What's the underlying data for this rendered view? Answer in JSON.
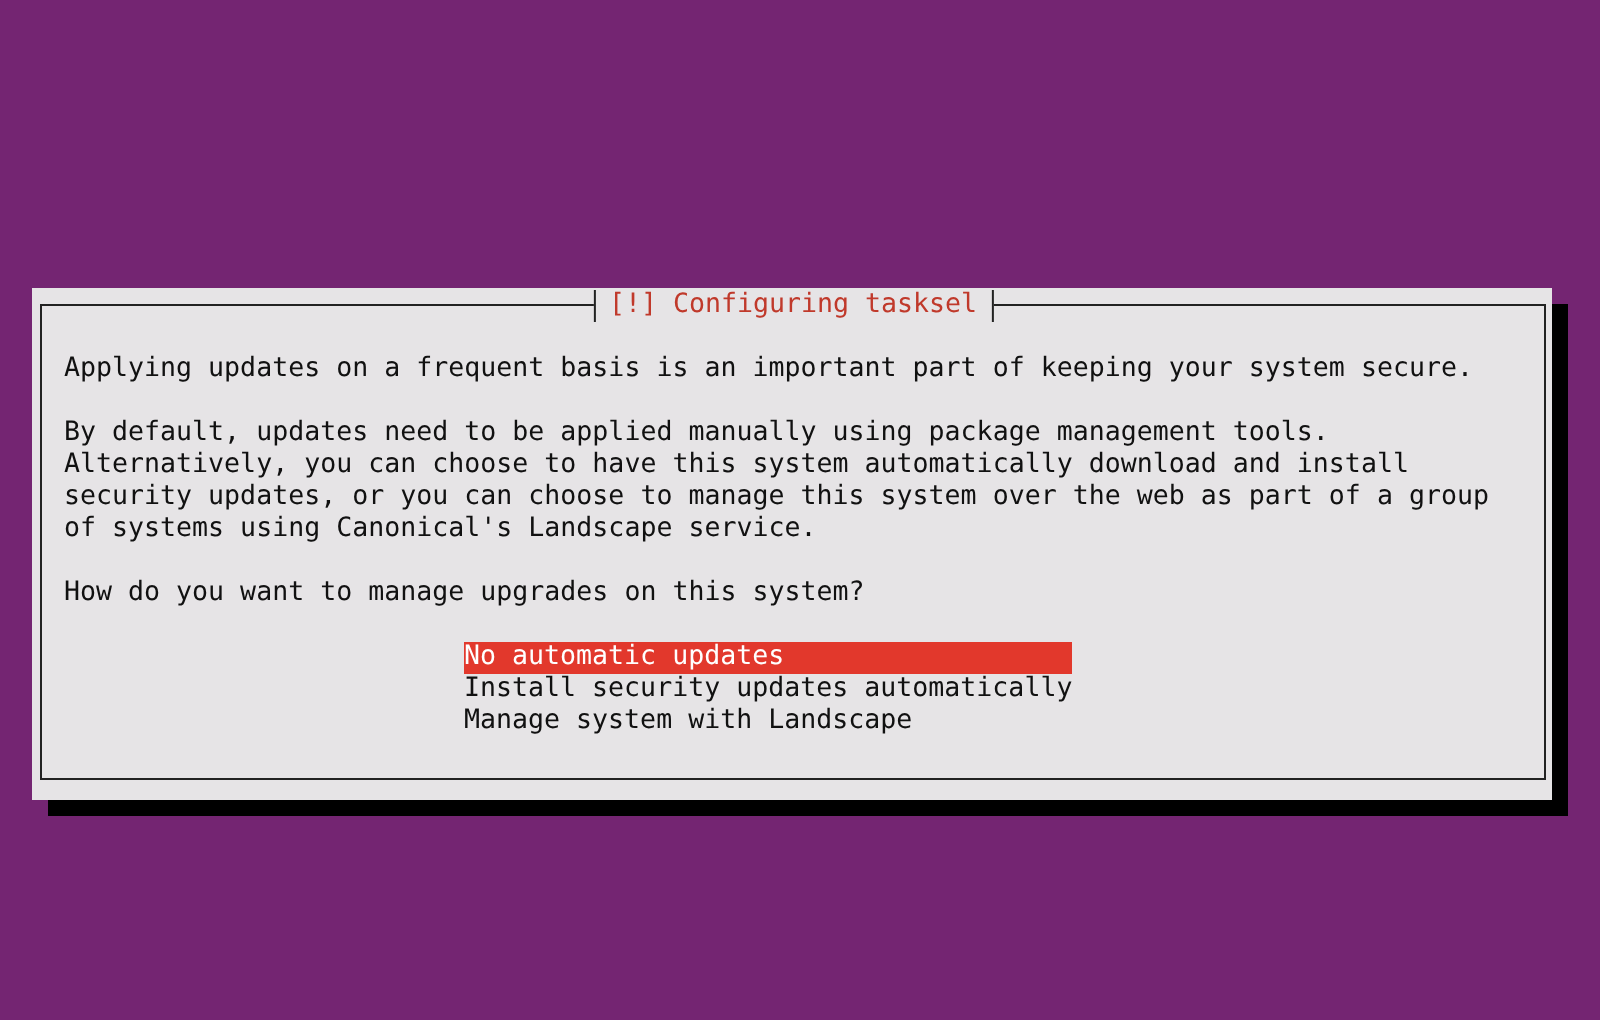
{
  "dialog": {
    "title": "[!] Configuring tasksel",
    "paragraphs": [
      "Applying updates on a frequent basis is an important part of keeping your system secure.",
      "By default, updates need to be applied manually using package management tools.\nAlternatively, you can choose to have this system automatically download and install\nsecurity updates, or you can choose to manage this system over the web as part of a group\nof systems using Canonical's Landscape service.",
      "How do you want to manage upgrades on this system?"
    ],
    "options": [
      {
        "label": "No automatic updates",
        "selected": true
      },
      {
        "label": "Install security updates automatically",
        "selected": false
      },
      {
        "label": "Manage system with Landscape",
        "selected": false
      }
    ]
  }
}
